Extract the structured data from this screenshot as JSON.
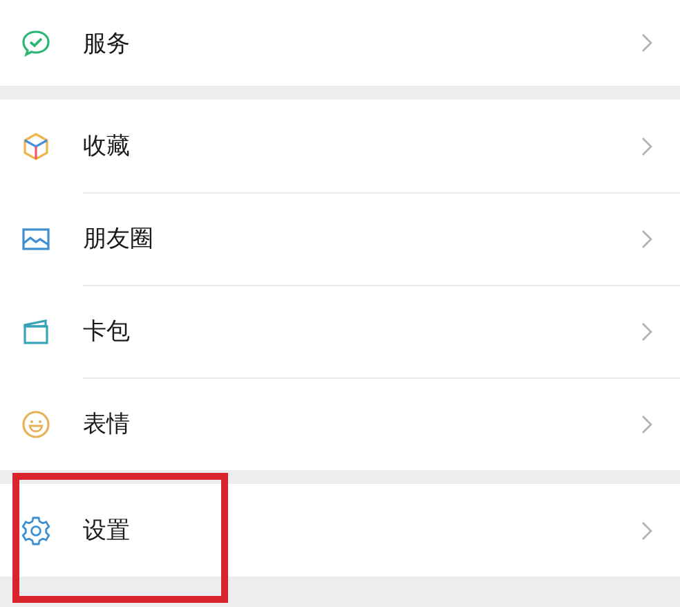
{
  "sections": [
    {
      "items": [
        {
          "kind": "service",
          "label": "服务",
          "highlighted": false
        }
      ]
    },
    {
      "items": [
        {
          "kind": "favorites",
          "label": "收藏",
          "highlighted": false
        },
        {
          "kind": "moments",
          "label": "朋友圈",
          "highlighted": false
        },
        {
          "kind": "cards",
          "label": "卡包",
          "highlighted": false
        },
        {
          "kind": "stickers",
          "label": "表情",
          "highlighted": false
        }
      ]
    },
    {
      "items": [
        {
          "kind": "settings",
          "label": "设置",
          "highlighted": true
        }
      ]
    }
  ]
}
